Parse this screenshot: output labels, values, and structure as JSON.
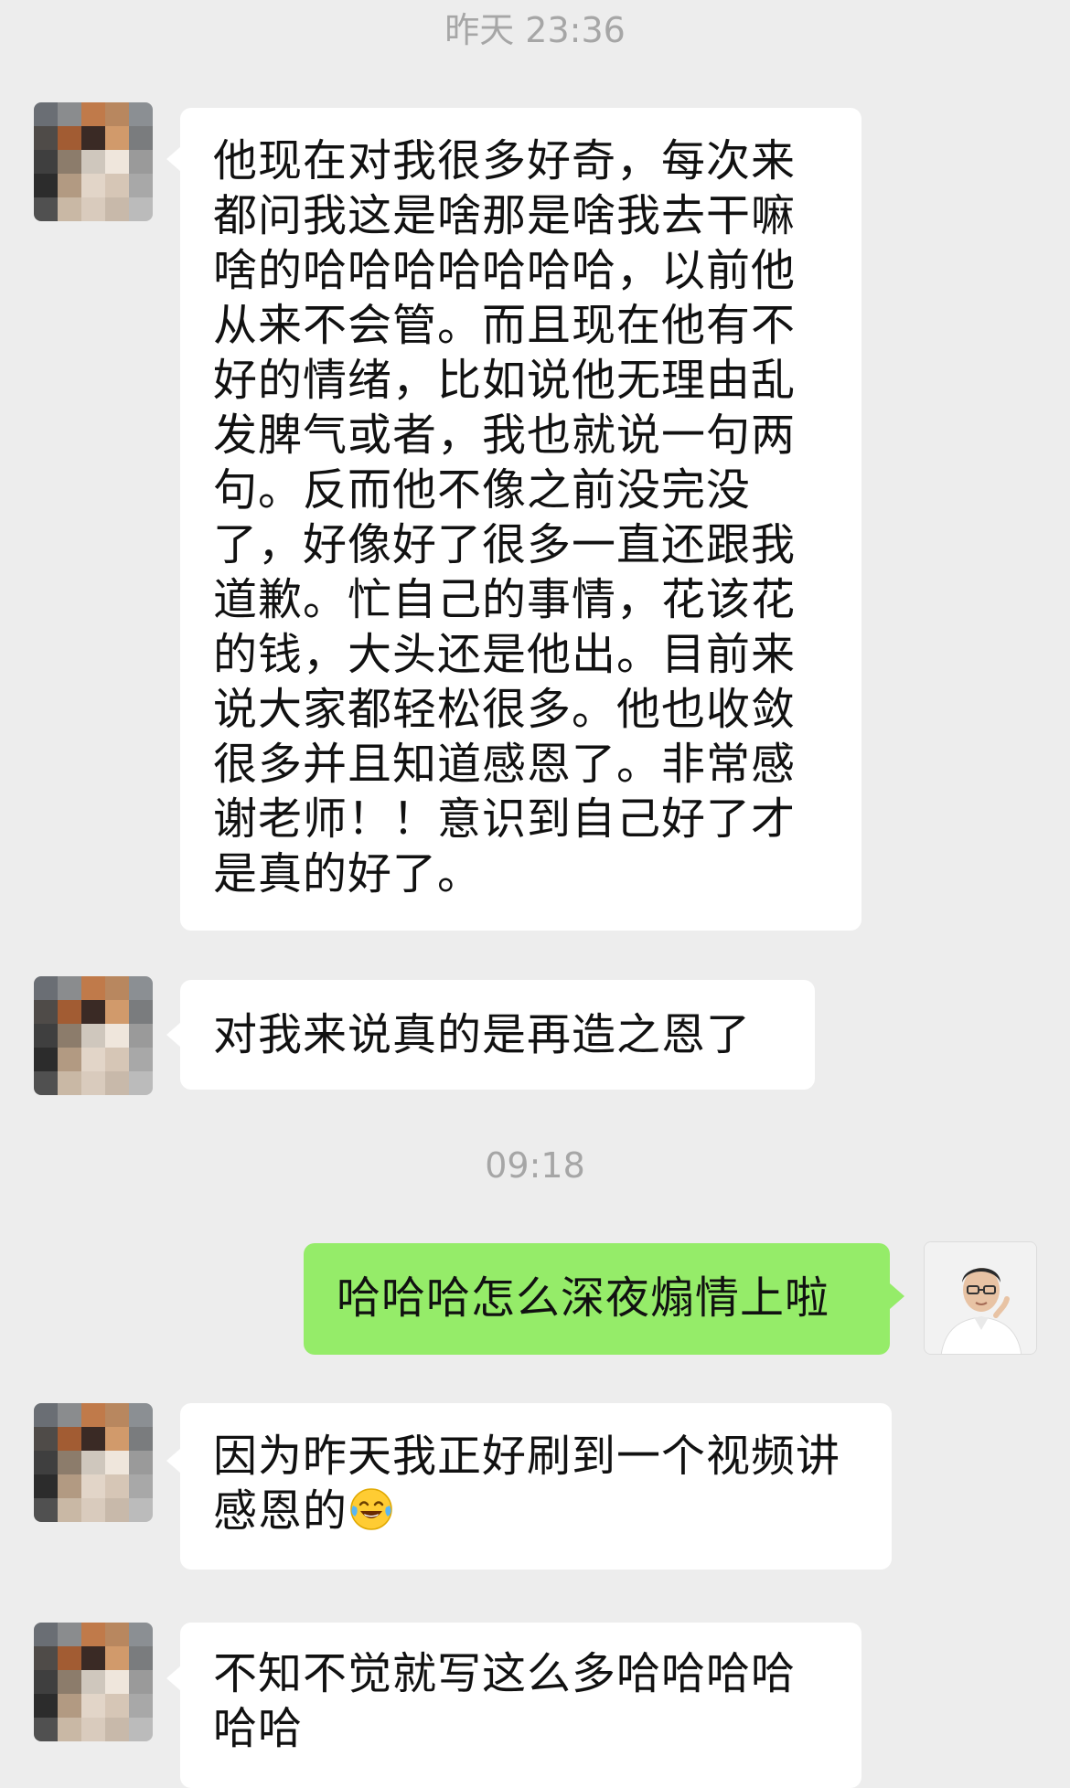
{
  "timestamps": [
    "昨天 23:36",
    "09:18"
  ],
  "messages": [
    {
      "sender": "other",
      "text": "他现在对我很多好奇，每次来都问我这是啥那是啥我去干嘛啥的哈哈哈哈哈哈哈，以前他从来不会管。而且现在他有不好的情绪，比如说他无理由乱发脾气或者，我也就说一句两句。反而他不像之前没完没了，好像好了很多一直还跟我道歉。忙自己的事情，花该花的钱，大头还是他出。目前来说大家都轻松很多。他也收敛很多并且知道感恩了。非常感谢老师！！意识到自己好了才是真的好了。"
    },
    {
      "sender": "other",
      "text": "对我来说真的是再造之恩了"
    },
    {
      "sender": "self",
      "text": "哈哈哈怎么深夜煽情上啦"
    },
    {
      "sender": "other",
      "text": "因为昨天我正好刷到一个视频讲感恩的",
      "emoji": "tears-of-joy-emoji"
    },
    {
      "sender": "other",
      "text": "不知不觉就写这么多哈哈哈哈哈哈"
    }
  ],
  "colors": {
    "background": "#ededed",
    "received_bubble": "#ffffff",
    "sent_bubble": "#95ec69",
    "timestamp_text": "#a6a6a6"
  }
}
